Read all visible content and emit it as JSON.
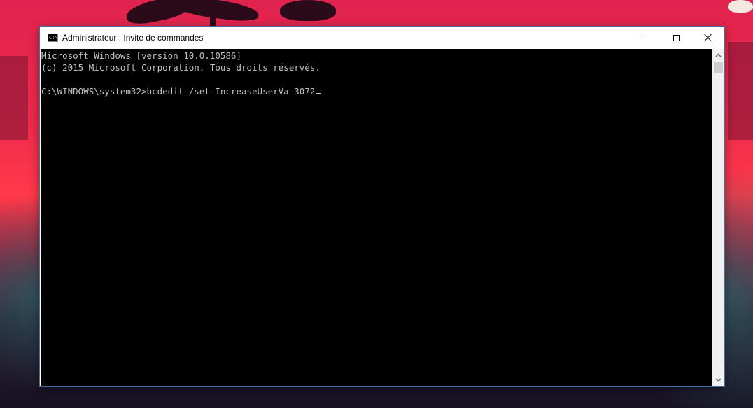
{
  "window": {
    "title": "Administrateur : Invite de commandes",
    "icon": "console-icon"
  },
  "console": {
    "lines": [
      "Microsoft Windows [version 10.0.10586]",
      "(c) 2015 Microsoft Corporation. Tous droits réservés.",
      "",
      "C:\\WINDOWS\\system32>bcdedit /set IncreaseUserVa 3072"
    ]
  },
  "colors": {
    "console_background": "#000000",
    "console_text": "#c0c0c0",
    "titlebar": "#ffffff",
    "window_border": "#4a6aa0"
  }
}
